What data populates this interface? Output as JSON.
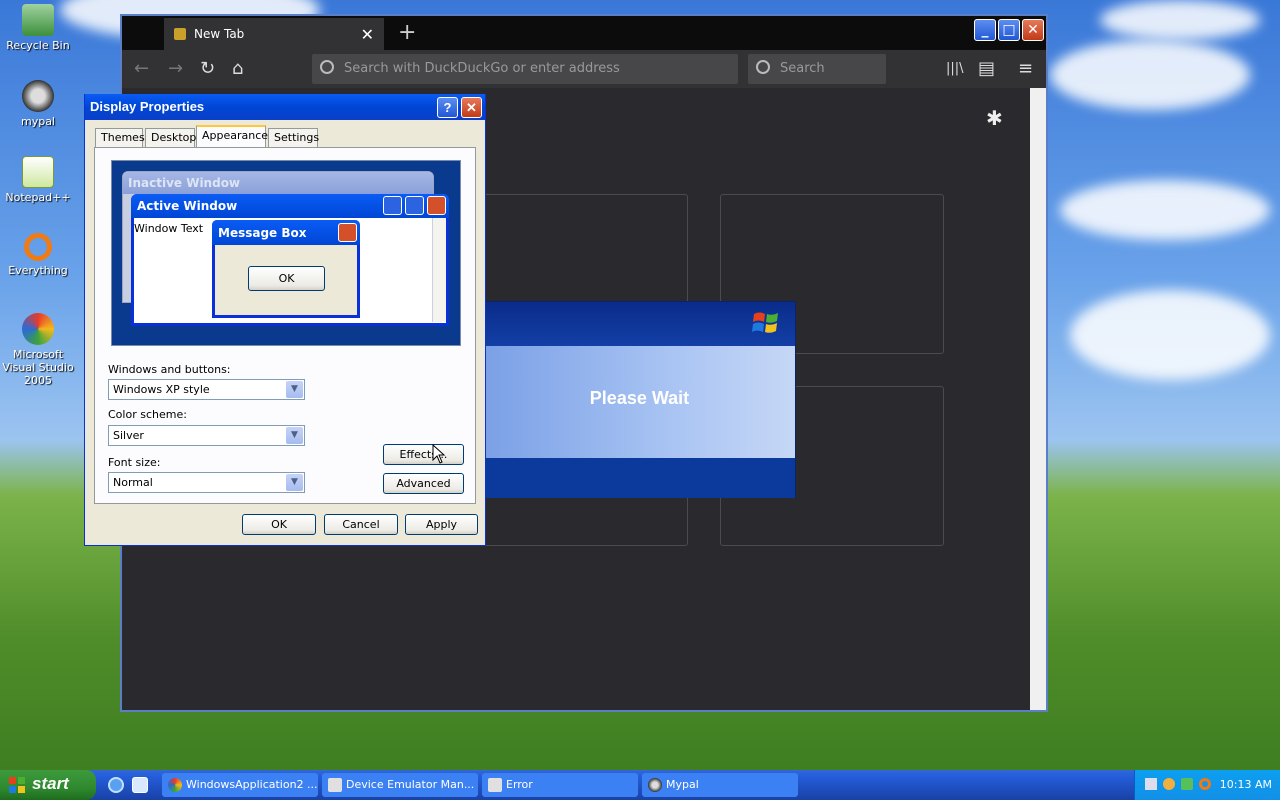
{
  "desktop": {
    "icons": [
      {
        "label": "Recycle Bin"
      },
      {
        "label": "mypal"
      },
      {
        "label": "Notepad++"
      },
      {
        "label": "Everything"
      },
      {
        "label": "Microsoft Visual Studio 2005"
      }
    ]
  },
  "browser": {
    "tab_title": "New Tab",
    "tab_close": "✕",
    "new_tab": "+",
    "url_placeholder": "Search with DuckDuckGo or enter address",
    "search_placeholder": "Search",
    "nav": {
      "back": "←",
      "forward": "→",
      "reload": "↻",
      "home": "⌂",
      "library": "|||\\",
      "sidebar": "▤",
      "menu": "≡"
    },
    "settings_icon": "✱",
    "window_buttons": {
      "minimize": "_",
      "maximize": "□",
      "close": "✕"
    }
  },
  "please_wait": {
    "text": "Please Wait"
  },
  "display_properties": {
    "title": "Display Properties",
    "help": "?",
    "close": "✕",
    "tabs": [
      "Themes",
      "Desktop",
      "Appearance",
      "Settings"
    ],
    "preview": {
      "inactive_window": "Inactive Window",
      "active_window": "Active Window",
      "window_text": "Window Text",
      "message_box": "Message Box",
      "ok": "OK"
    },
    "windows_buttons_label": "Windows and buttons:",
    "windows_buttons_value": "Windows XP style",
    "color_scheme_label": "Color scheme:",
    "color_scheme_value": "Silver",
    "font_size_label": "Font size:",
    "font_size_value": "Normal",
    "effects": "Effects...",
    "advanced": "Advanced",
    "ok": "OK",
    "cancel": "Cancel",
    "apply": "Apply"
  },
  "taskbar": {
    "start": "start",
    "items": [
      {
        "label": "WindowsApplication2 ..."
      },
      {
        "label": "Device Emulator Man..."
      },
      {
        "label": "Error"
      },
      {
        "label": "Mypal"
      }
    ],
    "clock": "10:13 AM"
  }
}
